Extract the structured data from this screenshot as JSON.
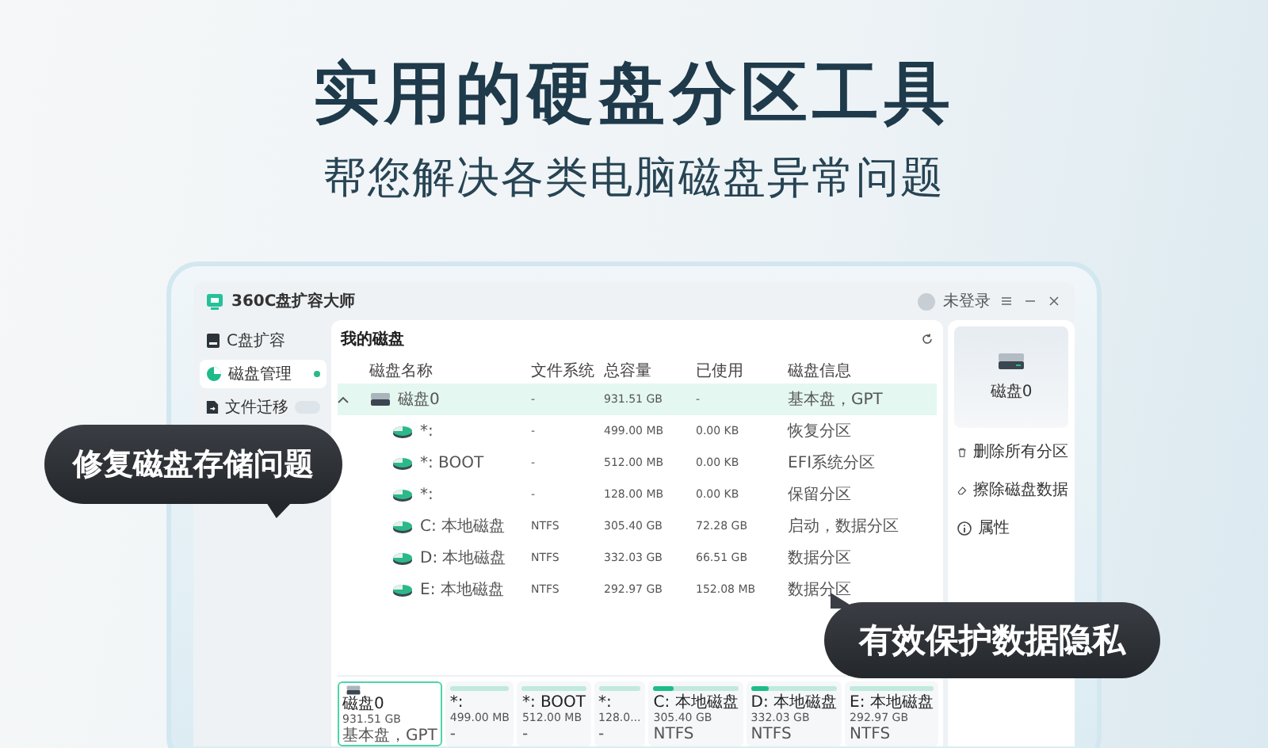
{
  "headline": "实用的硬盘分区工具",
  "subtitle": "帮您解决各类电脑磁盘异常问题",
  "app": {
    "title": "360C盘扩容大师",
    "user": "未登录",
    "sidebar": [
      {
        "kind": "expand",
        "label": "C盘扩容",
        "selected": false,
        "badge": false
      },
      {
        "kind": "manage",
        "label": "磁盘管理",
        "selected": true,
        "badge": false
      },
      {
        "kind": "migrate",
        "label": "文件迁移",
        "selected": false,
        "badge": true
      }
    ],
    "panel_title": "我的磁盘",
    "columns": [
      "磁盘名称",
      "文件系统",
      "总容量",
      "已使用",
      "磁盘信息"
    ],
    "rows": [
      {
        "kind": "disk",
        "expanded": true,
        "selected": true,
        "name": "磁盘0",
        "fs": "-",
        "total": "931.51 GB",
        "used": "-",
        "info": "基本盘，GPT",
        "children": [
          {
            "kind": "partition",
            "selected": false,
            "name": "*:",
            "fs": "-",
            "total": "499.00 MB",
            "used": "0.00 KB",
            "info": "恢复分区"
          },
          {
            "kind": "partition",
            "selected": false,
            "name": "*: BOOT",
            "fs": "-",
            "total": "512.00 MB",
            "used": "0.00 KB",
            "info": "EFI系统分区"
          },
          {
            "kind": "partition",
            "selected": false,
            "name": "*:",
            "fs": "-",
            "total": "128.00 MB",
            "used": "0.00 KB",
            "info": "保留分区"
          },
          {
            "kind": "partition",
            "selected": false,
            "name": "C: 本地磁盘",
            "fs": "NTFS",
            "total": "305.40 GB",
            "used": "72.28 GB",
            "info": "启动，数据分区"
          },
          {
            "kind": "partition",
            "selected": false,
            "name": "D: 本地磁盘",
            "fs": "NTFS",
            "total": "332.03 GB",
            "used": "66.51 GB",
            "info": "数据分区"
          },
          {
            "kind": "partition",
            "selected": false,
            "name": "E: 本地磁盘",
            "fs": "NTFS",
            "total": "292.97 GB",
            "used": "152.08 MB",
            "info": "数据分区"
          }
        ]
      }
    ],
    "right_panel": {
      "disk": "磁盘0",
      "actions": [
        {
          "kind": "delete",
          "label": "删除所有分区"
        },
        {
          "kind": "erase",
          "label": "擦除磁盘数据"
        },
        {
          "kind": "info",
          "label": "属性"
        }
      ]
    },
    "cards": [
      {
        "kind": "disk",
        "selected": true,
        "name": "磁盘0",
        "size": "931.51 GB",
        "detail": "基本盘，GPT"
      },
      {
        "kind": "partition",
        "selected": false,
        "name": "*:",
        "size": "499.00 MB",
        "detail": "-"
      },
      {
        "kind": "partition",
        "selected": false,
        "name": "*: BOOT",
        "size": "512.00 MB",
        "detail": "-"
      },
      {
        "kind": "partition",
        "selected": false,
        "name": "*:",
        "size": "128.0...",
        "detail": "-"
      },
      {
        "kind": "partition",
        "selected": false,
        "level": 0.24,
        "name": "C: 本地磁盘",
        "size": "305.40 GB",
        "detail": "NTFS"
      },
      {
        "kind": "partition",
        "selected": false,
        "level": 0.2,
        "name": "D: 本地磁盘",
        "size": "332.03 GB",
        "detail": "NTFS"
      },
      {
        "kind": "partition",
        "selected": false,
        "name": "E: 本地磁盘",
        "size": "292.97 GB",
        "detail": "NTFS"
      }
    ]
  },
  "callouts": [
    "修复磁盘存储问题",
    "有效保护数据隐私"
  ]
}
